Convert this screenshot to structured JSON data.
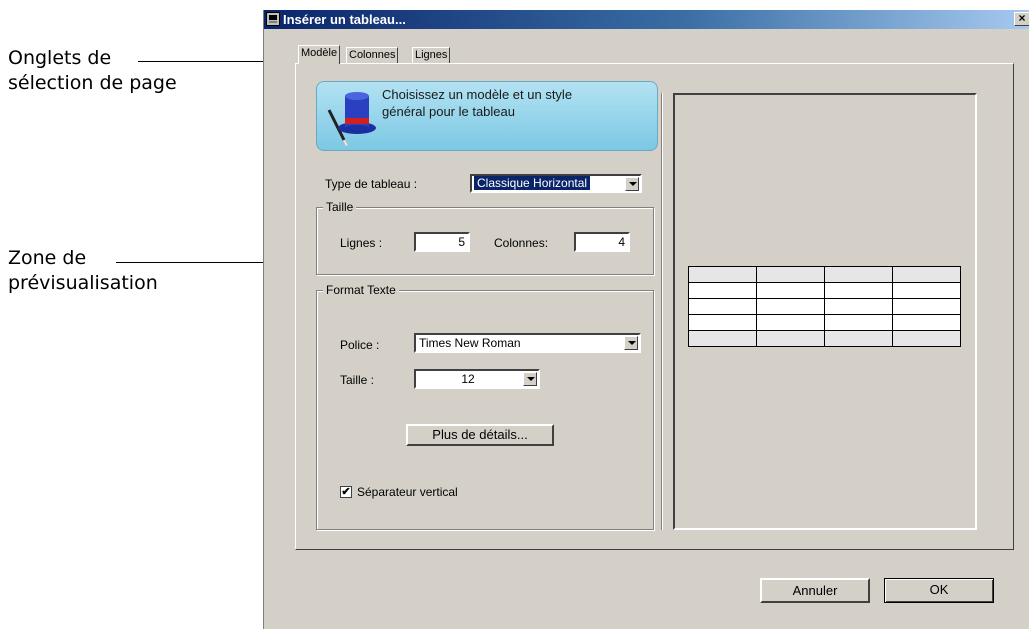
{
  "annotations": {
    "tabs_label_line1": "Onglets de",
    "tabs_label_line2": "sélection de page",
    "preview_label_line1": "Zone de",
    "preview_label_line2": "prévisualisation"
  },
  "window": {
    "title": "Insérer un tableau...",
    "close_glyph": "×"
  },
  "tabs": [
    {
      "label": "Modèle",
      "active": true
    },
    {
      "label": "Colonnes",
      "active": false
    },
    {
      "label": "Lignes",
      "active": false
    }
  ],
  "banner": {
    "line1": "Choisissez un modèle et un style",
    "line2": "général pour le tableau"
  },
  "type_tableau": {
    "label": "Type de tableau :",
    "value": "Classique Horizontal"
  },
  "taille_group": {
    "title": "Taille",
    "lignes_label": "Lignes :",
    "lignes_value": "5",
    "colonnes_label": "Colonnes:",
    "colonnes_value": "4"
  },
  "format_texte": {
    "title": "Format Texte",
    "police_label": "Police :",
    "police_value": "Times New Roman",
    "taille_label": "Taille :",
    "taille_value": "12",
    "details_button": "Plus de détails...",
    "separator_label": "Séparateur vertical",
    "separator_checked": true,
    "check_glyph": "✔"
  },
  "preview": {
    "rows": 5,
    "columns": 4
  },
  "footer": {
    "cancel": "Annuler",
    "ok": "OK"
  },
  "colors": {
    "dialog_bg": "#d4d0c8",
    "titlebar_start": "#0a246a",
    "titlebar_end": "#a6caf0",
    "selection": "#0a246a",
    "banner": "#9fd6ec"
  }
}
